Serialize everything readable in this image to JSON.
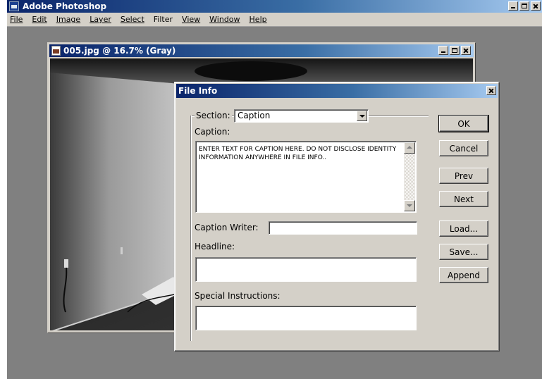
{
  "app": {
    "title": "Adobe Photoshop",
    "menu": [
      "File",
      "Edit",
      "Image",
      "Layer",
      "Select",
      "Filter",
      "View",
      "Window",
      "Help"
    ]
  },
  "document": {
    "title": "005.jpg @ 16.7% (Gray)"
  },
  "dialog": {
    "title": "File Info",
    "section_label": "Section:",
    "section_value": "Caption",
    "caption_label": "Caption:",
    "caption_text": "ENTER TEXT FOR CAPTION HERE.  DO NOT DISCLOSE IDENTITY INFORMATION ANYWHERE IN FILE INFO..",
    "caption_writer_label": "Caption Writer:",
    "caption_writer_value": "",
    "headline_label": "Headline:",
    "headline_value": "",
    "special_instructions_label": "Special Instructions:",
    "special_instructions_value": "",
    "buttons": {
      "ok": "OK",
      "cancel": "Cancel",
      "prev": "Prev",
      "next": "Next",
      "load": "Load...",
      "save": "Save...",
      "append": "Append"
    }
  }
}
